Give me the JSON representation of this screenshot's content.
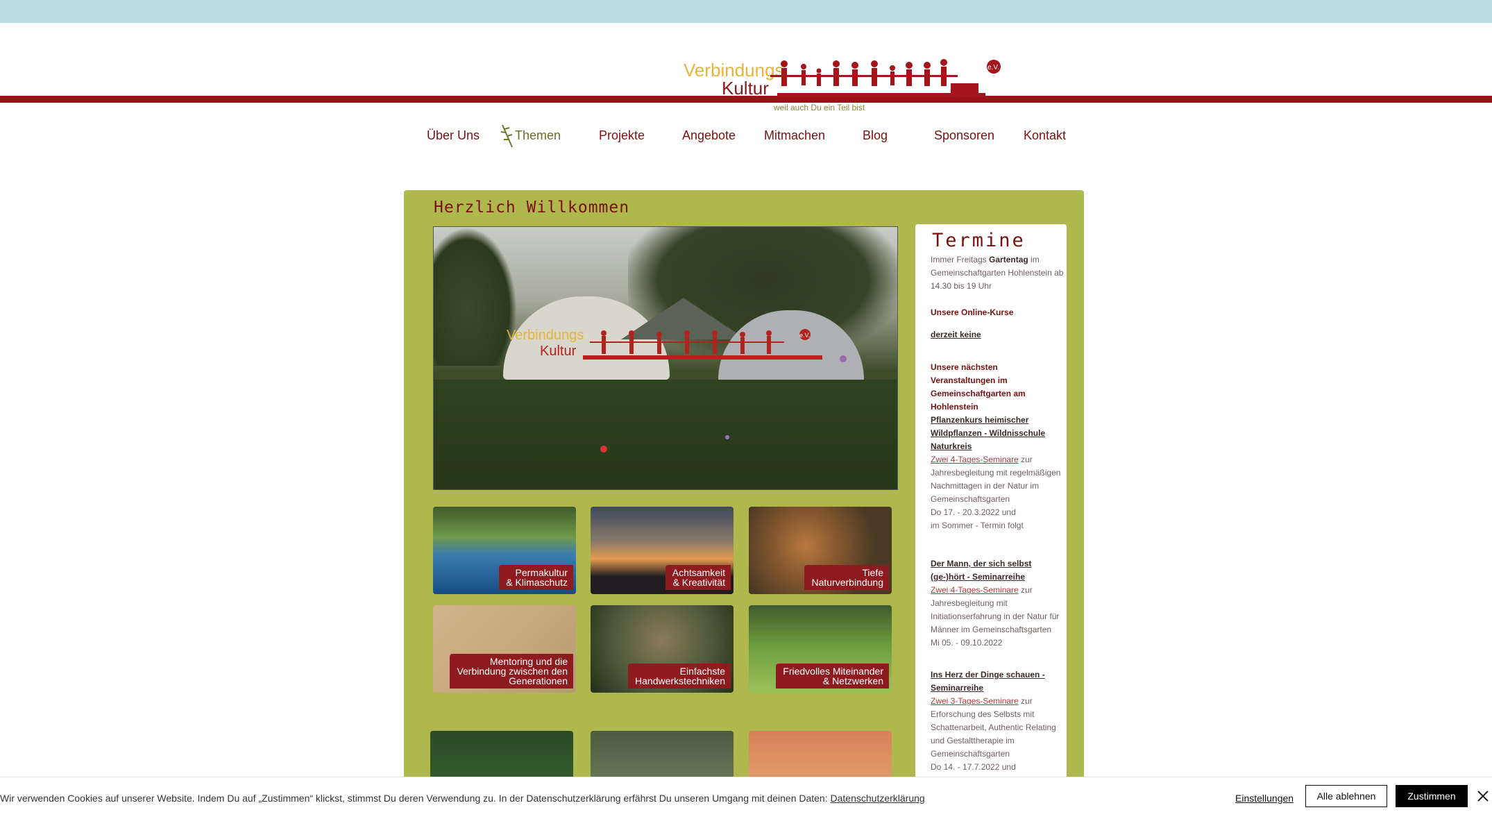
{
  "logo": {
    "word1": "Verbindungs",
    "word2": "Kultur",
    "badge": "e.V.",
    "tagline": "weil auch Du ein Teil bist"
  },
  "nav": [
    {
      "label": "Über Uns",
      "active": false
    },
    {
      "label": "Themen",
      "active": true
    },
    {
      "label": "Projekte",
      "active": false
    },
    {
      "label": "Angebote",
      "active": false
    },
    {
      "label": "Mitmachen",
      "active": false
    },
    {
      "label": "Blog",
      "active": false
    },
    {
      "label": "Sponsoren",
      "active": false
    },
    {
      "label": "Kontakt",
      "active": false
    }
  ],
  "main": {
    "heading": "Herzlich Willkommen",
    "hero_logo": {
      "word1": "Verbindungs",
      "word2": "Kultur",
      "badge": "e.V."
    },
    "tiles": [
      {
        "label": "Permakultur\n& Klimaschutz"
      },
      {
        "label": "Achtsamkeit\n& Kreativität"
      },
      {
        "label": "Tiefe\nNaturverbindung"
      },
      {
        "label": "Mentoring und die\nVerbindung zwischen den\nGenerationen"
      },
      {
        "label": "Einfachste\nHandwerkstechniken"
      },
      {
        "label": "Friedvolles Miteinander\n& Netzwerken"
      }
    ]
  },
  "sidebar": {
    "title": "Termine",
    "friday_1": "Immer Freitags ",
    "friday_bold": "Gartentag",
    "friday_2": " im Gemeinschaftgarten Hohlenstein ab 14.30 bis 19 Uhr",
    "online_heading": "Unsere Online-Kurse",
    "online_none": "derzeit keine",
    "events_heading": "Unsere nächsten Veranstaltungen im Gemeinschaftgarten am Hohlenstein",
    "event1_title": "Pflanzenkurs heimischer Wildpflanzen - Wildnisschule Naturkreis",
    "event1_link": "Zwei 4-Tages-Seminare",
    "event1_text": " zur Jahresbegleitung mit regelmäßigen Nachmittagen in der Natur im Gemeinschaftsgarten",
    "event1_date": "Do 17. - 20.3.2022 und",
    "event1_date2": "im Sommer - Termin folgt",
    "event2_title": "Der Mann, der sich selbst (ge-)hört - Seminarreihe",
    "event2_link": "Zwei 4-Tages-Seminare",
    "event2_text": " zur Jahresbegleitung mit Initiationserfahrung in der Natur für Männer im Gemeinschaftsgarten",
    "event2_date": "Mi 05. - 09.10.2022",
    "event3_title": "Ins Herz der Dinge schauen - Seminarreihe",
    "event3_link": "Zwei 3-Tages-Seminare",
    "event3_text": " zur Erforschung des Selbsts mit Schattenarbeit, Authentic Relating und Gestalttherapie im Gemeinschaftsgarten",
    "event3_date": "Do 14. - 17.7.2022 und"
  },
  "cookie": {
    "text": "Wir verwenden Cookies auf unserer Website. Indem Du auf „Zustimmen“ klickst, stimmst Du deren Verwendung zu. In der Datenschutzerklärung erfährst Du unseren Umgang mit deinen Daten: ",
    "link": "Datenschutzerklärung",
    "settings": "Einstellungen",
    "reject": "Alle ablehnen",
    "accept": "Zustimmen"
  },
  "colors": {
    "brand_red": "#9b1116",
    "panel_green": "#aeb84c",
    "topbar": "#b9dde0",
    "logo_gold": "#e6b43a"
  }
}
